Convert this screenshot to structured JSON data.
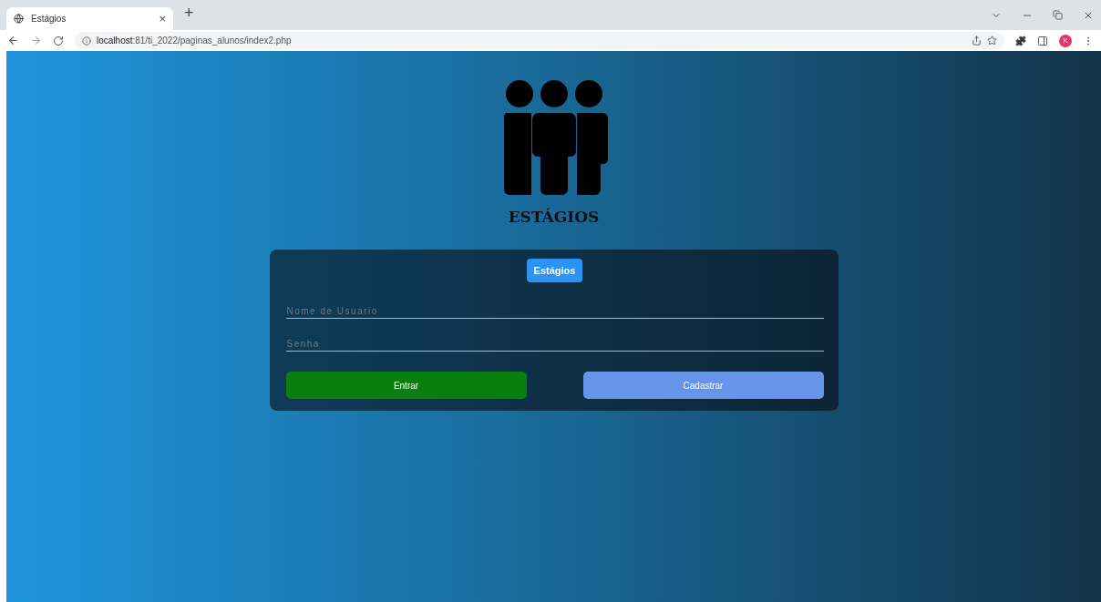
{
  "browser": {
    "tab_title": "Estágios",
    "tab_close": "×",
    "new_tab": "+",
    "url": "**localhost**:81/ti_2022/paginas_alunos/index2.php",
    "profile_initial": "K"
  },
  "page": {
    "logo_title": "ESTÁGIOS",
    "badge": "Estágios",
    "fields": [
      {
        "placeholder": "Nome de Usuario"
      },
      {
        "placeholder": "Senha"
      }
    ],
    "buttons": [
      {
        "label": "Entrar",
        "kind": "primary"
      },
      {
        "label": "Cadastrar",
        "kind": "secondary"
      }
    ]
  }
}
